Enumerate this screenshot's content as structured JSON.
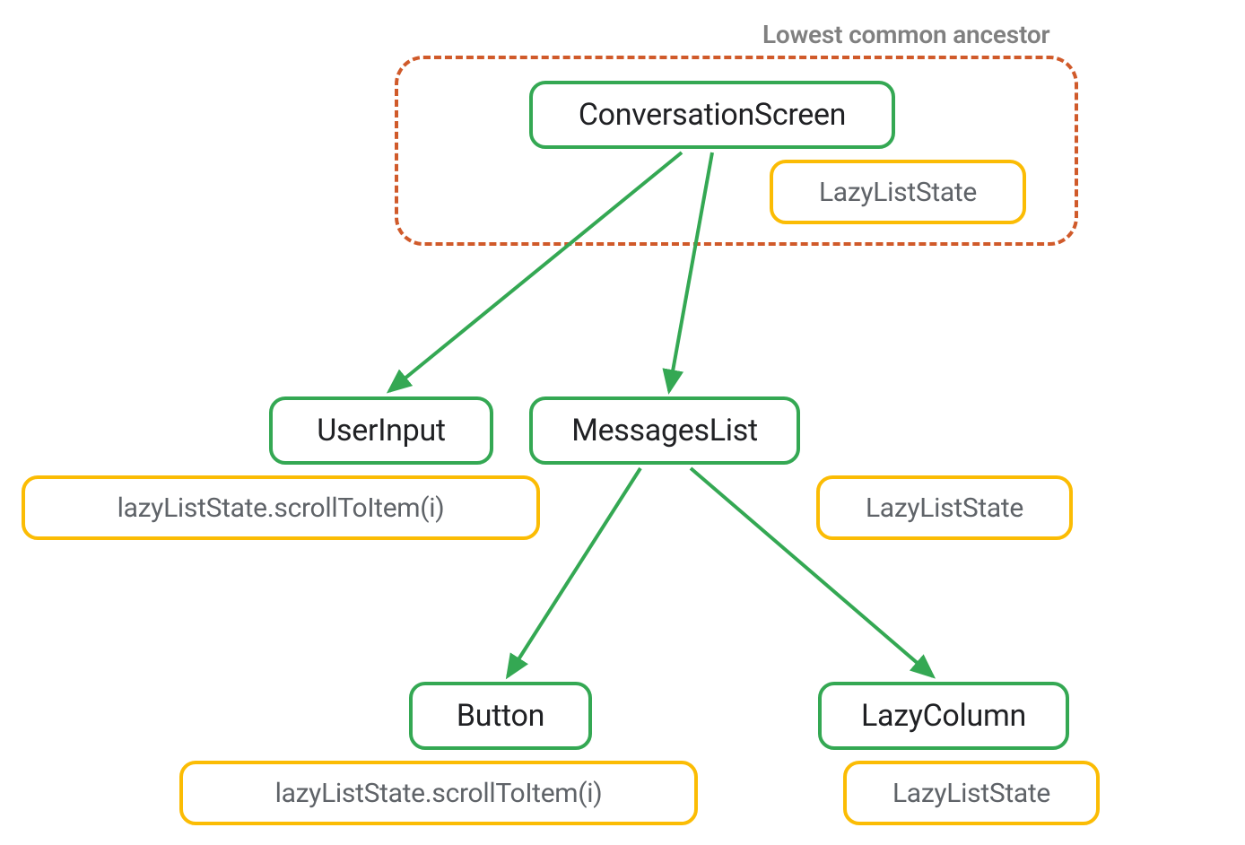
{
  "diagram": {
    "ancestor_label": "Lowest common ancestor",
    "nodes": {
      "conversation_screen": "ConversationScreen",
      "lazy_list_state_top": "LazyListState",
      "user_input": "UserInput",
      "user_input_state": "lazyListState.scrollToItem(i)",
      "messages_list": "MessagesList",
      "messages_list_state": "LazyListState",
      "button": "Button",
      "button_state": "lazyListState.scrollToItem(i)",
      "lazy_column": "LazyColumn",
      "lazy_column_state": "LazyListState"
    },
    "colors": {
      "green": "#34a853",
      "yellow": "#fbbc04",
      "dashed": "#d05a2a",
      "text_primary": "#202124",
      "text_secondary": "#5f6368",
      "label_gray": "#808080"
    }
  }
}
